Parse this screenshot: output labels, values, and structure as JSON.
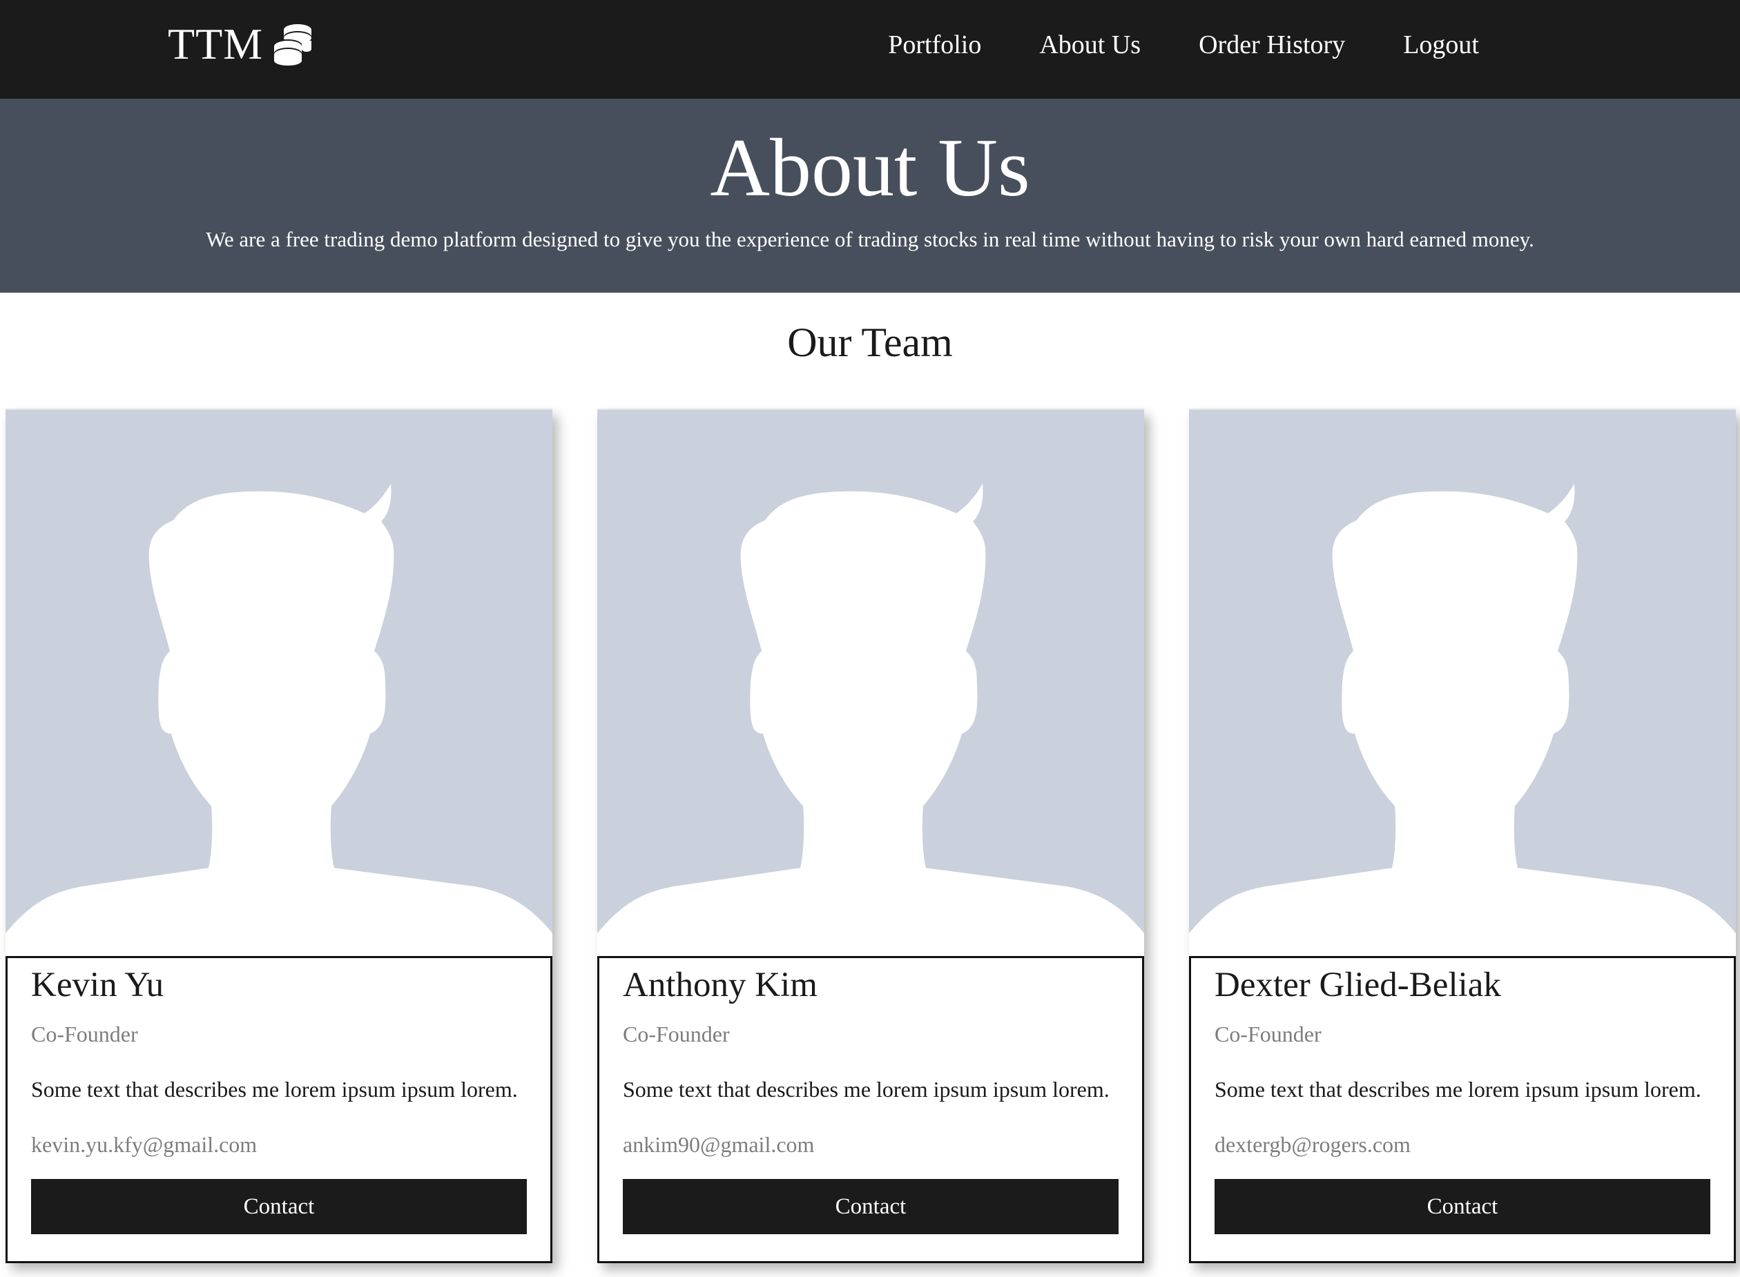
{
  "navbar": {
    "brand": "TTM",
    "brand_icon": "coins-stack-icon",
    "links": [
      {
        "label": "Portfolio"
      },
      {
        "label": "About Us"
      },
      {
        "label": "Order History"
      },
      {
        "label": "Logout"
      }
    ]
  },
  "hero": {
    "title": "About Us",
    "description": "We are a free trading demo platform designed to give you the experience of trading stocks in real time without having to risk your own hard earned money."
  },
  "team": {
    "title": "Our Team",
    "members": [
      {
        "name": "Kevin Yu",
        "role": "Co-Founder",
        "description": "Some text that describes me lorem ipsum ipsum lorem.",
        "email": "kevin.yu.kfy@gmail.com",
        "button_label": "Contact",
        "photo_icon": "avatar-placeholder-icon"
      },
      {
        "name": "Anthony Kim",
        "role": "Co-Founder",
        "description": "Some text that describes me lorem ipsum ipsum lorem.",
        "email": "ankim90@gmail.com",
        "button_label": "Contact",
        "photo_icon": "avatar-placeholder-icon"
      },
      {
        "name": "Dexter Glied-Beliak",
        "role": "Co-Founder",
        "description": "Some text that describes me lorem ipsum ipsum lorem.",
        "email": "dextergb@rogers.com",
        "button_label": "Contact",
        "photo_icon": "avatar-placeholder-icon"
      }
    ]
  },
  "colors": {
    "navbar_bg": "#1b1b1b",
    "hero_bg": "#484f5c",
    "avatar_bg": "#cbd0dd",
    "button_bg": "#1b1b1b",
    "muted_text": "#7d7d7d"
  }
}
